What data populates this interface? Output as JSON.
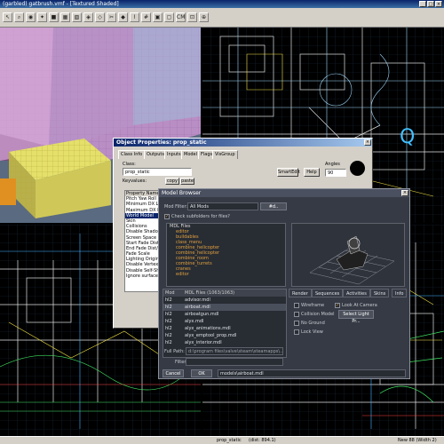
{
  "window": {
    "title": "(garbled) gatbrush.vmf - [Textured Shaded]",
    "min": "_",
    "max": "□",
    "close": "×"
  },
  "toolbar": {
    "buttons": [
      {
        "icon": "arrow-tool-icon",
        "glyph": "↖"
      },
      {
        "icon": "magnify-icon",
        "glyph": "⌕"
      },
      {
        "icon": "camera-icon",
        "glyph": "◉"
      },
      {
        "icon": "entity-tool-icon",
        "glyph": "✦"
      },
      {
        "icon": "block-tool-icon",
        "glyph": "■"
      },
      {
        "icon": "texture-tool-icon",
        "glyph": "▦"
      },
      {
        "icon": "apply-texture-icon",
        "glyph": "▧"
      },
      {
        "icon": "decal-tool-icon",
        "glyph": "◈"
      },
      {
        "icon": "overlay-tool-icon",
        "glyph": "◇"
      },
      {
        "icon": "clip-tool-icon",
        "glyph": "✂"
      },
      {
        "icon": "vertex-tool-icon",
        "glyph": "◆"
      },
      {
        "icon": "path-tool-icon",
        "glyph": "⌇"
      },
      {
        "icon": "grid-icon",
        "glyph": "#"
      },
      {
        "icon": "group-icon",
        "glyph": "▣"
      },
      {
        "icon": "cordon-icon",
        "glyph": "▢"
      },
      {
        "icon": "cm-icon",
        "glyph": "CM"
      },
      {
        "icon": "texture-lock-icon",
        "glyph": "⊡"
      },
      {
        "icon": "zoom-icon",
        "glyph": "⊕"
      }
    ]
  },
  "object_properties": {
    "title": "Object Properties: prop_static",
    "close": "×",
    "tabs": [
      "Class Info",
      "Outputs",
      "Inputs",
      "Model",
      "Flags",
      "VisGroup"
    ],
    "class_label": "Class:",
    "class_value": "prop_static",
    "keyvalues_label": "Keyvalues:",
    "copy": "copy",
    "paste": "paste",
    "smartedit": "SmartEdit",
    "help": "Help",
    "angles_label": "Angles",
    "angles_value": "90",
    "properties": [
      "Property Name",
      "Pitch Yaw Roll (Y Z X)",
      "Minimum DX Level",
      "Maximum DX Level",
      "World Model",
      "Skin",
      "Collisions",
      "Disable Shadows",
      "Screen Space Fade",
      "Start Fade Dist/Pixels",
      "End Fade Dist/Pixels",
      "Fade Scale",
      "Lighting Origin",
      "Disable Vertex lighting",
      "Disable Self-Shadowing",
      "Ignore surface normal"
    ]
  },
  "model_browser": {
    "title": "Model Browser",
    "close": "×",
    "mod_filter_label": "Mod Filter:",
    "mod_filter_value": "All Mods",
    "subfolder_check": "Check subfolders for files?",
    "tree_root": "MDL Files",
    "tree_items": [
      "editor",
      "buildables",
      "class_menu",
      "combine_helicopter",
      "combine_helicopter",
      "combine_room",
      "combine_turrets",
      "cranes",
      "editor"
    ],
    "list_headers": [
      "Mod",
      "MDL Files (1063/1063)"
    ],
    "list_rows": [
      {
        "mod": "hl2",
        "file": "advisor.mdl"
      },
      {
        "mod": "hl2",
        "file": "airboat.mdl"
      },
      {
        "mod": "hl2",
        "file": "airboatgun.mdl"
      },
      {
        "mod": "hl2",
        "file": "alyx.mdl"
      },
      {
        "mod": "hl2",
        "file": "alyx_animations.mdl"
      },
      {
        "mod": "hl2",
        "file": "alyx_emptool_prop.mdl"
      },
      {
        "mod": "hl2",
        "file": "alyx_interior.mdl"
      }
    ],
    "tabs": [
      "Render",
      "Sequences",
      "Activities",
      "Skins",
      "Info"
    ],
    "wireframe": "Wireframe",
    "look_at_camera": "Look At Camera",
    "collision_model": "Collision Model",
    "select_light": "Select Light Pr...",
    "no_ground": "No Ground",
    "lock_view": "Lock View",
    "fullpath_label": "Full Path:",
    "fullpath_value": "d:\\program files\\valve\\steam\\steamapps\\...",
    "filter_label": "Filter:",
    "cancel": "Cancel",
    "ok": "OK",
    "selection": "models\\airboat.mdl"
  },
  "status": {
    "left": "",
    "middle": "prop_static",
    "coords": "(dist: 894.1)",
    "right": "New 88 (Width 2)"
  }
}
